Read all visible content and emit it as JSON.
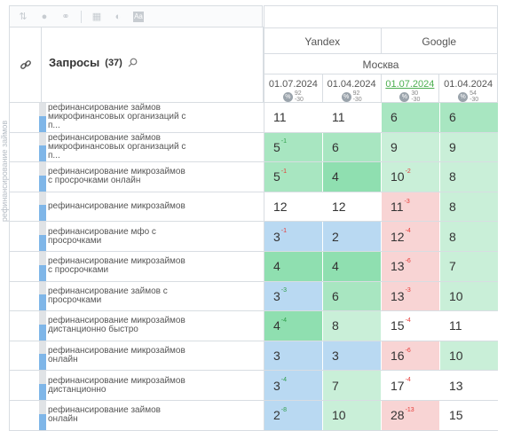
{
  "toolbar": {
    "icons": [
      "sort-icon",
      "toggle-icon",
      "link-icon",
      "table-icon",
      "contrast-icon",
      "font-icon"
    ]
  },
  "side_label": "рефинансирование займов",
  "header": {
    "query_label": "Запросы",
    "query_count": "(37)",
    "engines": [
      "Yandex",
      "Google"
    ],
    "region": "Москва",
    "dates": [
      {
        "date": "01.07.2024",
        "top": "92",
        "bottom": "-30",
        "highlight": false
      },
      {
        "date": "01.04.2024",
        "top": "92",
        "bottom": "-30",
        "highlight": false
      },
      {
        "date": "01.07.2024",
        "top": "30",
        "bottom": "-30",
        "highlight": true
      },
      {
        "date": "01.04.2024",
        "top": "54",
        "bottom": "-30",
        "highlight": false
      }
    ]
  },
  "rows": [
    {
      "query": [
        "рефинансирование займов",
        "микрофинансовых организаций с",
        "п..."
      ],
      "cells": [
        {
          "v": "11",
          "d": "",
          "t": "",
          "c": "c-white"
        },
        {
          "v": "11",
          "d": "",
          "t": "",
          "c": "c-white"
        },
        {
          "v": "6",
          "d": "",
          "t": "",
          "c": "c-green"
        },
        {
          "v": "6",
          "d": "",
          "t": "",
          "c": "c-green"
        }
      ]
    },
    {
      "query": [
        "рефинансирование займов",
        "микрофинансовых организаций с",
        "п..."
      ],
      "cells": [
        {
          "v": "5",
          "d": "-1",
          "t": "up",
          "c": "c-green"
        },
        {
          "v": "6",
          "d": "",
          "t": "",
          "c": "c-green"
        },
        {
          "v": "9",
          "d": "",
          "t": "",
          "c": "c-lgreen"
        },
        {
          "v": "9",
          "d": "",
          "t": "",
          "c": "c-lgreen"
        }
      ]
    },
    {
      "query": [
        "рефинансирование микрозаймов",
        "с просрочками онлайн"
      ],
      "cells": [
        {
          "v": "5",
          "d": "-1",
          "t": "down",
          "c": "c-green"
        },
        {
          "v": "4",
          "d": "",
          "t": "",
          "c": "c-dgreen"
        },
        {
          "v": "10",
          "d": "-2",
          "t": "down",
          "c": "c-lgreen"
        },
        {
          "v": "8",
          "d": "",
          "t": "",
          "c": "c-lgreen"
        }
      ]
    },
    {
      "query": [
        "рефинансирование микрозаймов"
      ],
      "cells": [
        {
          "v": "12",
          "d": "",
          "t": "",
          "c": "c-white"
        },
        {
          "v": "12",
          "d": "",
          "t": "",
          "c": "c-white"
        },
        {
          "v": "11",
          "d": "-3",
          "t": "down",
          "c": "c-pink"
        },
        {
          "v": "8",
          "d": "",
          "t": "",
          "c": "c-lgreen"
        }
      ]
    },
    {
      "query": [
        "рефинансирование мфо с",
        "просрочками"
      ],
      "cells": [
        {
          "v": "3",
          "d": "-1",
          "t": "down",
          "c": "c-blue"
        },
        {
          "v": "2",
          "d": "",
          "t": "",
          "c": "c-blue"
        },
        {
          "v": "12",
          "d": "-4",
          "t": "down",
          "c": "c-pink"
        },
        {
          "v": "8",
          "d": "",
          "t": "",
          "c": "c-lgreen"
        }
      ]
    },
    {
      "query": [
        "рефинансирование микрозаймов",
        "с просрочками"
      ],
      "cells": [
        {
          "v": "4",
          "d": "",
          "t": "",
          "c": "c-dgreen"
        },
        {
          "v": "4",
          "d": "",
          "t": "",
          "c": "c-dgreen"
        },
        {
          "v": "13",
          "d": "-6",
          "t": "down",
          "c": "c-pink"
        },
        {
          "v": "7",
          "d": "",
          "t": "",
          "c": "c-lgreen"
        }
      ]
    },
    {
      "query": [
        "рефинансирование займов с",
        "просрочками"
      ],
      "cells": [
        {
          "v": "3",
          "d": "-3",
          "t": "up",
          "c": "c-blue"
        },
        {
          "v": "6",
          "d": "",
          "t": "",
          "c": "c-green"
        },
        {
          "v": "13",
          "d": "-3",
          "t": "down",
          "c": "c-pink"
        },
        {
          "v": "10",
          "d": "",
          "t": "",
          "c": "c-lgreen"
        }
      ]
    },
    {
      "query": [
        "рефинансирование микрозаймов",
        "дистанционно быстро"
      ],
      "cells": [
        {
          "v": "4",
          "d": "-4",
          "t": "up",
          "c": "c-dgreen"
        },
        {
          "v": "8",
          "d": "",
          "t": "",
          "c": "c-lgreen"
        },
        {
          "v": "15",
          "d": "-4",
          "t": "down",
          "c": "c-white"
        },
        {
          "v": "11",
          "d": "",
          "t": "",
          "c": "c-white"
        }
      ]
    },
    {
      "query": [
        "рефинансирование микрозаймов",
        "онлайн"
      ],
      "cells": [
        {
          "v": "3",
          "d": "",
          "t": "",
          "c": "c-blue"
        },
        {
          "v": "3",
          "d": "",
          "t": "",
          "c": "c-blue"
        },
        {
          "v": "16",
          "d": "-6",
          "t": "down",
          "c": "c-pink"
        },
        {
          "v": "10",
          "d": "",
          "t": "",
          "c": "c-lgreen"
        }
      ]
    },
    {
      "query": [
        "рефинансирование микрозаймов",
        "дистанционно"
      ],
      "cells": [
        {
          "v": "3",
          "d": "-4",
          "t": "up",
          "c": "c-blue"
        },
        {
          "v": "7",
          "d": "",
          "t": "",
          "c": "c-lgreen"
        },
        {
          "v": "17",
          "d": "-4",
          "t": "down",
          "c": "c-white"
        },
        {
          "v": "13",
          "d": "",
          "t": "",
          "c": "c-white"
        }
      ]
    },
    {
      "query": [
        "рефинансирование займов",
        "онлайн"
      ],
      "cells": [
        {
          "v": "2",
          "d": "-8",
          "t": "up",
          "c": "c-blue"
        },
        {
          "v": "10",
          "d": "",
          "t": "",
          "c": "c-lgreen"
        },
        {
          "v": "28",
          "d": "-13",
          "t": "down",
          "c": "c-pink"
        },
        {
          "v": "15",
          "d": "",
          "t": "",
          "c": "c-white"
        }
      ]
    }
  ]
}
